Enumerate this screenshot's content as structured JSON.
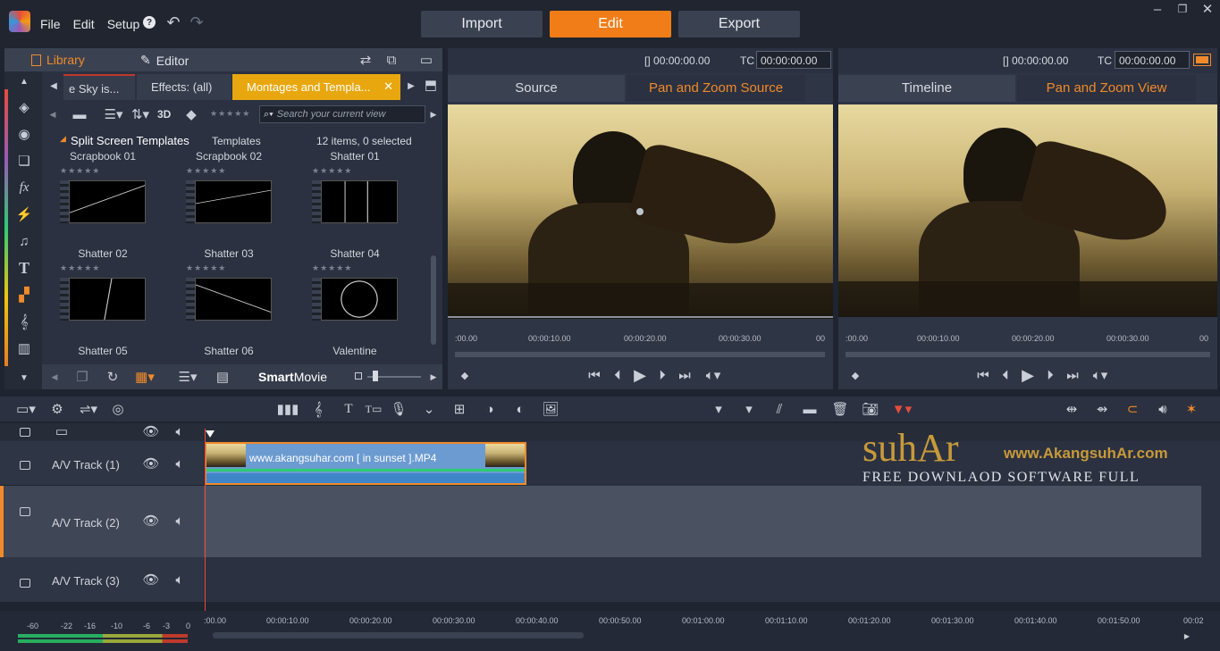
{
  "menu": {
    "file": "File",
    "edit": "Edit",
    "setup": "Setup"
  },
  "modes": {
    "import": "Import",
    "edit": "Edit",
    "export": "Export"
  },
  "library_header": {
    "library": "Library",
    "editor": "Editor"
  },
  "library_tabs": [
    "e Sky is...",
    "Effects: (all)",
    "Montages and Templa..."
  ],
  "search": {
    "placeholder": "Search your current view",
    "threed": "3D"
  },
  "category": {
    "title": "Split Screen Templates",
    "sub": "Templates",
    "count": "12 items, 0 selected"
  },
  "templates": [
    "Scrapbook 01",
    "Scrapbook 02",
    "Shatter 01",
    "Shatter 02",
    "Shatter 03",
    "Shatter 04",
    "Shatter 05",
    "Shatter 06",
    "Valentine"
  ],
  "library_bottom": {
    "smart": "Smart",
    "movie": "Movie"
  },
  "source_player": {
    "tc1": "00:00:00.00",
    "tc_label": "TC",
    "tc2": "00:00:00.00",
    "tab1": "Source",
    "tab2": "Pan and Zoom Source",
    "ruler": [
      ":00.00",
      "00:00:10.00",
      "00:00:20.00",
      "00:00:30.00",
      "00"
    ]
  },
  "timeline_player": {
    "tc1": "00:00:00.00",
    "tc_label": "TC",
    "tc2": "00:00:00.00",
    "tab1": "Timeline",
    "tab2": "Pan and Zoom View",
    "ruler": [
      ":00.00",
      "00:00:10.00",
      "00:00:20.00",
      "00:00:30.00",
      "00"
    ]
  },
  "tracks": [
    {
      "name": "A/V Track (1)"
    },
    {
      "name": "A/V Track (2)"
    },
    {
      "name": "A/V Track (3)"
    }
  ],
  "clip": {
    "label": "www.akangsuhar.com [ in sunset ].MP4"
  },
  "watermark": {
    "logo": "suhAr",
    "url": "www.AkangsuhAr.com",
    "tagline": "Free downlaod software full version"
  },
  "meter": [
    "-60",
    "-22",
    "-16",
    "-10",
    "-6",
    "-3",
    "0"
  ],
  "timeline_ruler": [
    ":00.00",
    "00:00:10.00",
    "00:00:20.00",
    "00:00:30.00",
    "00:00:40.00",
    "00:00:50.00",
    "00:01:00.00",
    "00:01:10.00",
    "00:01:20.00",
    "00:01:30.00",
    "00:01:40.00",
    "00:01:50.00",
    "00:02"
  ],
  "colors": {
    "accent": "#f07d17",
    "clip": "#6b9bd1"
  }
}
